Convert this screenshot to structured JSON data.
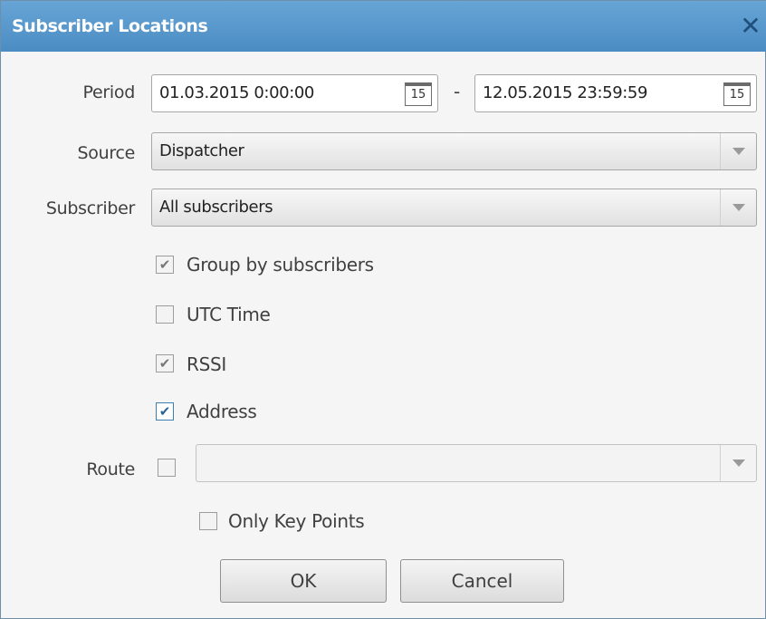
{
  "window": {
    "title": "Subscriber Locations",
    "close_glyph": "✕"
  },
  "period": {
    "label": "Period",
    "from": "01.03.2015 0:00:00",
    "to": "12.05.2015 23:59:59",
    "separator": "-",
    "calendar_day": "15"
  },
  "source": {
    "label": "Source",
    "selected": "Dispatcher"
  },
  "subscriber": {
    "label": "Subscriber",
    "selected": "All subscribers"
  },
  "options": {
    "group_by_subscribers": {
      "label": "Group by subscribers",
      "checked": true
    },
    "utc_time": {
      "label": "UTC Time",
      "checked": false
    },
    "rssi": {
      "label": "RSSI",
      "checked": true
    },
    "address": {
      "label": "Address",
      "checked": true
    }
  },
  "route": {
    "label": "Route",
    "enabled": false,
    "selected": "",
    "only_key_points": {
      "label": "Only Key Points",
      "checked": false
    }
  },
  "buttons": {
    "ok": "OK",
    "cancel": "Cancel"
  },
  "colors": {
    "titlebar": "#4a8cc3",
    "accent": "#3c7fb1"
  },
  "check_glyph": "✔"
}
